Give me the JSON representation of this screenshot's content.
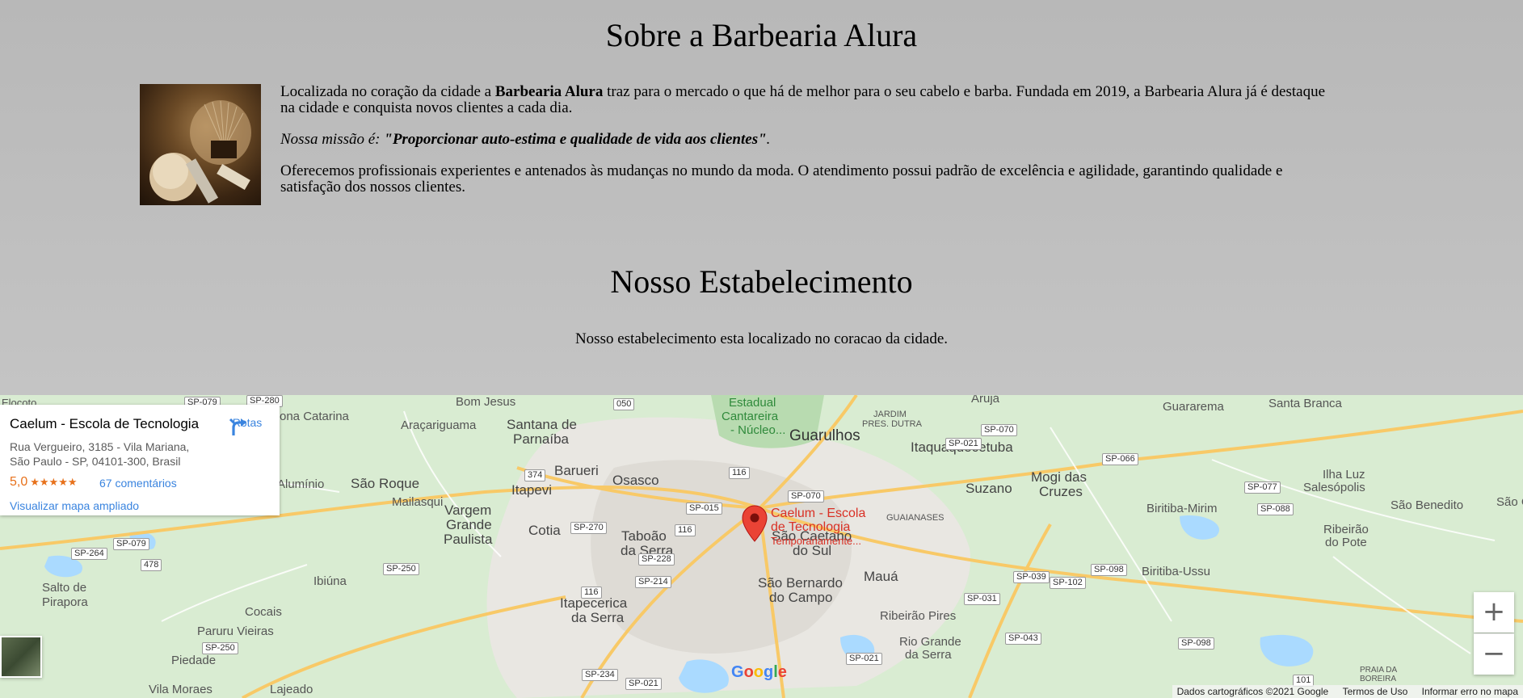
{
  "about": {
    "title": "Sobre a Barbearia Alura",
    "p1_pre": "Localizada no coração da cidade a ",
    "p1_bold": "Barbearia Alura",
    "p1_post": " traz para o mercado o que há de melhor para o seu cabelo e barba. Fundada em 2019, a Barbearia Alura já é destaque na cidade e conquista novos clientes a cada dia.",
    "p2_pre": "Nossa missão é: ",
    "p2_bold": "\"Proporcionar auto-estima e qualidade de vida aos clientes\"",
    "p2_post": ".",
    "p3": "Oferecemos profissionais experientes e antenados às mudanças no mundo da moda. O atendimento possui padrão de excelência e agilidade, garantindo qualidade e satisfação dos nossos clientes."
  },
  "establishment": {
    "title": "Nosso Estabelecimento",
    "description": "Nosso estabelecimento esta localizado no coracao da cidade."
  },
  "map": {
    "place_card": {
      "name": "Caelum - Escola de Tecnologia",
      "address_line1": "Rua Vergueiro, 3185 - Vila Mariana,",
      "address_line2": "São Paulo - SP, 04101-300, Brasil",
      "rating": "5,0",
      "stars": "★★★★★",
      "reviews": "67 comentários",
      "larger_map": "Visualizar mapa ampliado",
      "directions": "Rotas"
    },
    "pin": {
      "line1": "Caelum - Escola",
      "line2": "de Tecnologia",
      "line3": "Temporariamente..."
    },
    "places": {
      "guarulhos": "Guarulhos",
      "osasco": "Osasco",
      "barueri": "Barueri",
      "sao_roque": "São Roque",
      "itapevi": "Itapevi",
      "cotia": "Cotia",
      "suzano": "Suzano",
      "maua": "Mauá",
      "itaquaquecetuba": "Itaquaquecetuba",
      "mogi_1": "Mogi das",
      "mogi_2": "Cruzes",
      "sbc_1": "São Bernardo",
      "sbc_2": "do Campo",
      "scs_1": "São Caetano",
      "scs_2": "do Sul",
      "taboao_1": "Taboão",
      "taboao_2": "da Serra",
      "itapecerica_1": "Itapecerica",
      "itapecerica_2": "da Serra",
      "vargem_1": "Vargem",
      "vargem_2": "Grande",
      "vargem_3": "Paulista",
      "santana_1": "Santana de",
      "santana_2": "Parnaíba",
      "aracariguama": "Araçariguama",
      "bom_jesus": "Bom Jesus",
      "mailasqui": "Mailasqui",
      "aluminio": "Alumínio",
      "ibiuna": "Ibiúna",
      "cocais": "Cocais",
      "paruru": "Paruru Vieiras",
      "piedade": "Piedade",
      "vila_moraes": "Vila Moraes",
      "lajeado": "Lajeado",
      "salto_1": "Salto de",
      "salto_2": "Pirapora",
      "guararema": "Guararema",
      "santa_branca": "Santa Branca",
      "ilha_luz": "Ilha Luz",
      "salesopolis": "Salesópolis",
      "sao_benedito": "São Benedito",
      "biritiba_mirim": "Biritiba-Mirim",
      "biritiba_ussu": "Biritiba-Ussu",
      "ribeirao_1": "Ribeirão",
      "ribeirao_2": "do Pote",
      "ribeirao_pires": "Ribeirão Pires",
      "rio_grande_1": "Rio Grande",
      "rio_grande_2": "da Serra",
      "guaianases": "GUAIANASES",
      "jardim_1": "JARDIM",
      "jardim_2": "PRES. DUTRA",
      "aruja": "Arujá",
      "cantareira_1": "Estadual",
      "cantareira_2": "Cantareira",
      "cantareira_3": "- Núcleo...",
      "ona_catarina": "ona Catarina",
      "praia_1": "PRAIA DA",
      "praia_2": "BOREIRA",
      "sao_cr": "São Cr",
      "elocoto": "Elocoto"
    },
    "roads": [
      "SP-079",
      "SP-280",
      "050",
      "SP-070",
      "SP-021",
      "374",
      "116",
      "SP-015",
      "SP-270",
      "116",
      "SP-228",
      "SP-214",
      "SP-250",
      "478",
      "SP-264",
      "SP-079",
      "SP-250",
      "116",
      "SP-234",
      "SP-021",
      "SP-039",
      "SP-102",
      "SP-098",
      "SP-031",
      "SP-043",
      "SP-021",
      "SP-098",
      "SP-066",
      "SP-077",
      "SP-088",
      "SP-070",
      "101"
    ],
    "google_logo": [
      "G",
      "o",
      "o",
      "g",
      "l",
      "e"
    ],
    "zoom_in": "+",
    "zoom_out": "−",
    "attribution": {
      "data": "Dados cartográficos ©2021 Google",
      "terms": "Termos de Uso",
      "report": "Informar erro no mapa"
    }
  }
}
